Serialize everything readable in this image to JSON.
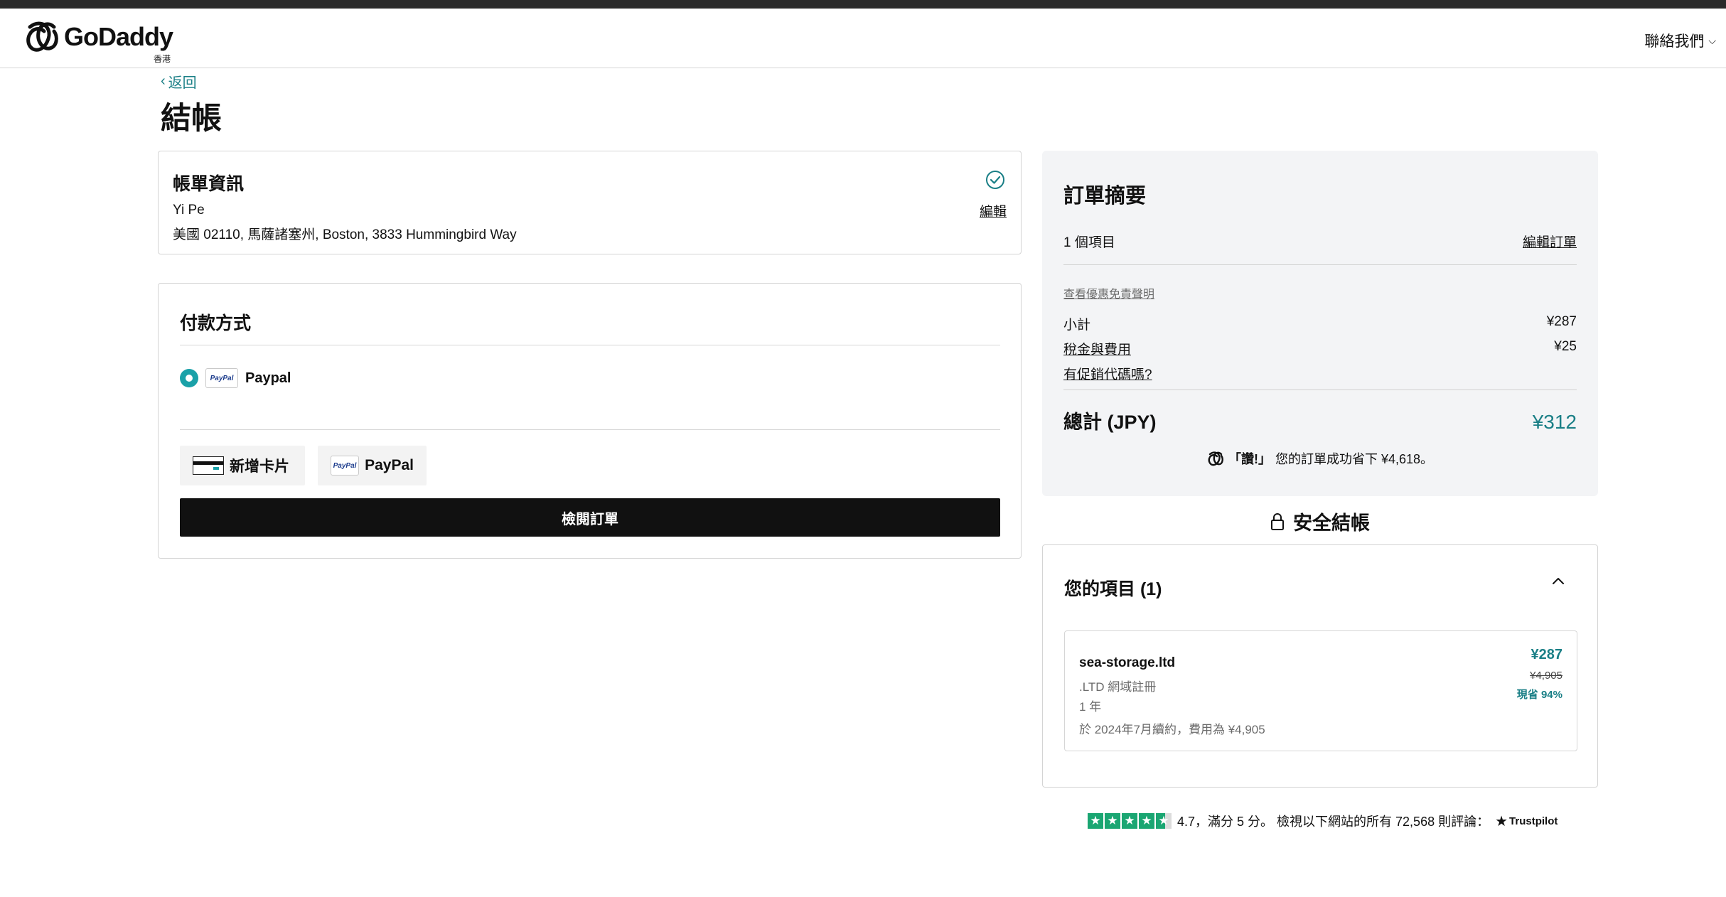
{
  "header": {
    "brand": "GoDaddy",
    "region": "香港",
    "contact_label": "聯絡我們"
  },
  "nav": {
    "back_label": "返回"
  },
  "page": {
    "title": "結帳"
  },
  "billing": {
    "heading": "帳單資訊",
    "name": "Yi Pe",
    "address": "美國 02110, 馬薩諸塞州, Boston, 3833 Hummingbird Way",
    "edit_label": "編輯"
  },
  "payment": {
    "heading": "付款方式",
    "selected_method": "Paypal",
    "paypal_chip": "PayPal",
    "add_card_label": "新增卡片",
    "paypal_button_label": "PayPal",
    "review_button": "檢閱訂單"
  },
  "summary": {
    "heading": "訂單摘要",
    "item_count": "1 個項目",
    "edit_order": "編輯訂單",
    "disclaimer": "查看優惠免責聲明",
    "subtotal_label": "小計",
    "subtotal": "¥287",
    "tax_label": "稅金與費用",
    "tax": "¥25",
    "promo_label": "有促銷代碼嗎?",
    "total_label": "總計 (JPY)",
    "total": "¥312",
    "savings_prefix": "「讚!」",
    "savings_text": "您的訂單成功省下 ¥4,618。"
  },
  "secure": {
    "label": "安全結帳"
  },
  "items": {
    "heading": "您的項目 (1)",
    "list": [
      {
        "domain": "sea-storage.ltd",
        "type": ".LTD 網域註冊",
        "term": "1 年",
        "renewal": "於 2024年7月續約，費用為 ¥4,905",
        "price": "¥287",
        "original": "¥4,905",
        "saving": "現省 94%"
      }
    ]
  },
  "trustpilot": {
    "rating_stars": 4.7,
    "text": "4.7，滿分 5 分。 檢視以下網站的所有 72,568 則評論：",
    "brand": "Trustpilot"
  },
  "colors": {
    "accent": "#1a7f86",
    "radio": "#1aa1a8",
    "primary_button": "#111111",
    "summary_bg": "#f3f4f6",
    "trust_green": "#1aa672"
  }
}
